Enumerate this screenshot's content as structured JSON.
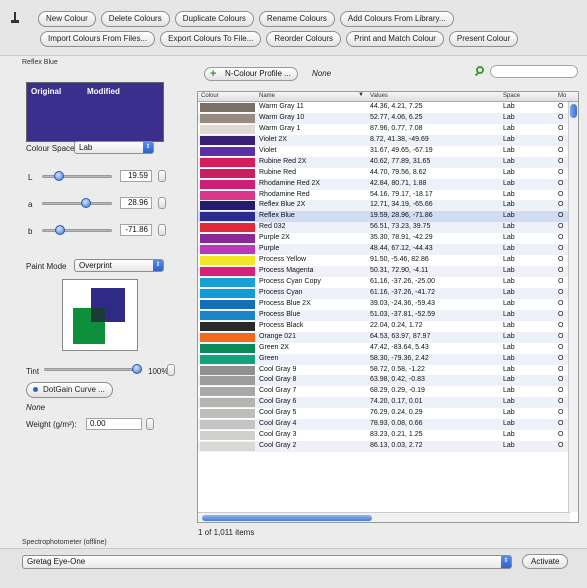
{
  "toolbar": {
    "row1": [
      "New Colour",
      "Delete Colours",
      "Duplicate Colours",
      "Rename Colours",
      "Add Colours From Library..."
    ],
    "row2": [
      "Import Colours From Files...",
      "Export Colours To File...",
      "Reorder Colours",
      "Print and Match Colour",
      "Present Colour"
    ]
  },
  "group_title": "Reflex Blue",
  "preview": {
    "original_label": "Original",
    "modified_label": "Modified",
    "color": "#3a2f8c"
  },
  "colour_space": {
    "label": "Colour Space",
    "value": "Lab"
  },
  "sliders": [
    {
      "label": "L",
      "value": "19.59",
      "level": 0.1959
    },
    {
      "label": "a",
      "value": "28.96",
      "level": 0.6448
    },
    {
      "label": "b",
      "value": "-71.86",
      "level": 0.2193
    }
  ],
  "paint_mode": {
    "label": "Paint Mode",
    "value": "Overprint"
  },
  "tint": {
    "label": "Tint",
    "value": "100%",
    "level": 1.0
  },
  "dotgain_button": "DotGain Curve ...",
  "dotgain_value": "None",
  "weight": {
    "label": "Weight (g/m²):",
    "value": "0.00"
  },
  "profile": {
    "button": "N-Colour Profile ...",
    "value": "None"
  },
  "table": {
    "columns": [
      "Colour",
      "Name",
      "Values",
      "Space",
      "Mo"
    ],
    "rows": [
      {
        "c": "#7a7165",
        "n": "Warm Gray 11",
        "v": "44.36, 4.21, 7.25",
        "s": "Lab",
        "m": "O"
      },
      {
        "c": "#968b7e",
        "n": "Warm Gray 10",
        "v": "52.77, 4.06, 6.25",
        "s": "Lab",
        "m": "O"
      },
      {
        "c": "#e0dbd2",
        "n": "Warm Gray 1",
        "v": "87.96, 0.77, 7.08",
        "s": "Lab",
        "m": "O"
      },
      {
        "c": "#3a1e73",
        "n": "Violet 2X",
        "v": "8.72, 41.38, -49.69",
        "s": "Lab",
        "m": "O"
      },
      {
        "c": "#5b2fa8",
        "n": "Violet",
        "v": "31.67, 49.65, -67.19",
        "s": "Lab",
        "m": "O"
      },
      {
        "c": "#d41f5c",
        "n": "Rubine Red 2X",
        "v": "40.62, 77.89, 31.65",
        "s": "Lab",
        "m": "O"
      },
      {
        "c": "#c81e63",
        "n": "Rubine Red",
        "v": "44.70, 79.56, 8.62",
        "s": "Lab",
        "m": "O"
      },
      {
        "c": "#cd1f77",
        "n": "Rhodamine Red 2X",
        "v": "42.84, 80.71, 1.88",
        "s": "Lab",
        "m": "O"
      },
      {
        "c": "#d9378c",
        "n": "Rhodamine Red",
        "v": "54.16, 79.17, -18.17",
        "s": "Lab",
        "m": "O"
      },
      {
        "c": "#241a6e",
        "n": "Reflex Blue 2X",
        "v": "12.71, 34.19, -65.66",
        "s": "Lab",
        "m": "O"
      },
      {
        "c": "#2a2a8f",
        "n": "Reflex Blue",
        "v": "19.59, 28.96, -71.86",
        "s": "Lab",
        "m": "O"
      },
      {
        "c": "#e02a3a",
        "n": "Red 032",
        "v": "56.51, 73.23, 39.75",
        "s": "Lab",
        "m": "O"
      },
      {
        "c": "#8a2a99",
        "n": "Purple 2X",
        "v": "35.30, 78.91, -42.29",
        "s": "Lab",
        "m": "O"
      },
      {
        "c": "#b83bb5",
        "n": "Purple",
        "v": "48.44, 67.12, -44.43",
        "s": "Lab",
        "m": "O"
      },
      {
        "c": "#f2e628",
        "n": "Process Yellow",
        "v": "91.50, -5.46, 82.86",
        "s": "Lab",
        "m": "O"
      },
      {
        "c": "#d81f7c",
        "n": "Process Magenta",
        "v": "50.31, 72.90, -4.11",
        "s": "Lab",
        "m": "O"
      },
      {
        "c": "#1aa0d6",
        "n": "Process Cyan Copy",
        "v": "61.16, -37.26, -25.00",
        "s": "Lab",
        "m": "O"
      },
      {
        "c": "#0f9ad8",
        "n": "Process Cyan",
        "v": "61.16, -37.26, -41.72",
        "s": "Lab",
        "m": "O"
      },
      {
        "c": "#1370b6",
        "n": "Process Blue 2X",
        "v": "39.03, -24.36, -59.43",
        "s": "Lab",
        "m": "O"
      },
      {
        "c": "#1b85c6",
        "n": "Process Blue",
        "v": "51.03, -37.81, -52.59",
        "s": "Lab",
        "m": "O"
      },
      {
        "c": "#2a2a2a",
        "n": "Process Black",
        "v": "22.04, 0.24, 1.72",
        "s": "Lab",
        "m": "O"
      },
      {
        "c": "#f26b1d",
        "n": "Orange 021",
        "v": "64.53, 63.97, 87.97",
        "s": "Lab",
        "m": "O"
      },
      {
        "c": "#0e8a5a",
        "n": "Green 2X",
        "v": "47.42, -83.64, 5.43",
        "s": "Lab",
        "m": "O"
      },
      {
        "c": "#14a27a",
        "n": "Green",
        "v": "58.30, -79.36, 2.42",
        "s": "Lab",
        "m": "O"
      },
      {
        "c": "#8f9190",
        "n": "Cool Gray 9",
        "v": "58.72, 0.58, -1.22",
        "s": "Lab",
        "m": "O"
      },
      {
        "c": "#9c9d9c",
        "n": "Cool Gray 8",
        "v": "63.98, 0.42, -0.83",
        "s": "Lab",
        "m": "O"
      },
      {
        "c": "#a8a8a7",
        "n": "Cool Gray 7",
        "v": "68.29, 0.29, -0.19",
        "s": "Lab",
        "m": "O"
      },
      {
        "c": "#b4b4b3",
        "n": "Cool Gray 6",
        "v": "74.20, 0.17, 0.01",
        "s": "Lab",
        "m": "O"
      },
      {
        "c": "#bdbdbc",
        "n": "Cool Gray 5",
        "v": "76.29, 0.24, 0.29",
        "s": "Lab",
        "m": "O"
      },
      {
        "c": "#c4c4c3",
        "n": "Cool Gray 4",
        "v": "78.93, 0.08, 0.66",
        "s": "Lab",
        "m": "O"
      },
      {
        "c": "#d0d0ce",
        "n": "Cool Gray 3",
        "v": "83.23, 0.21, 1.25",
        "s": "Lab",
        "m": "O"
      },
      {
        "c": "#d8d8d6",
        "n": "Cool Gray 2",
        "v": "86.13, 0.03, 2.72",
        "s": "Lab",
        "m": "O"
      }
    ],
    "selected": 10,
    "count": "1 of 1,011 items"
  },
  "device": {
    "label": "Spectrophotometer (offline)",
    "value": "Gretag Eye-One",
    "activate": "Activate"
  }
}
